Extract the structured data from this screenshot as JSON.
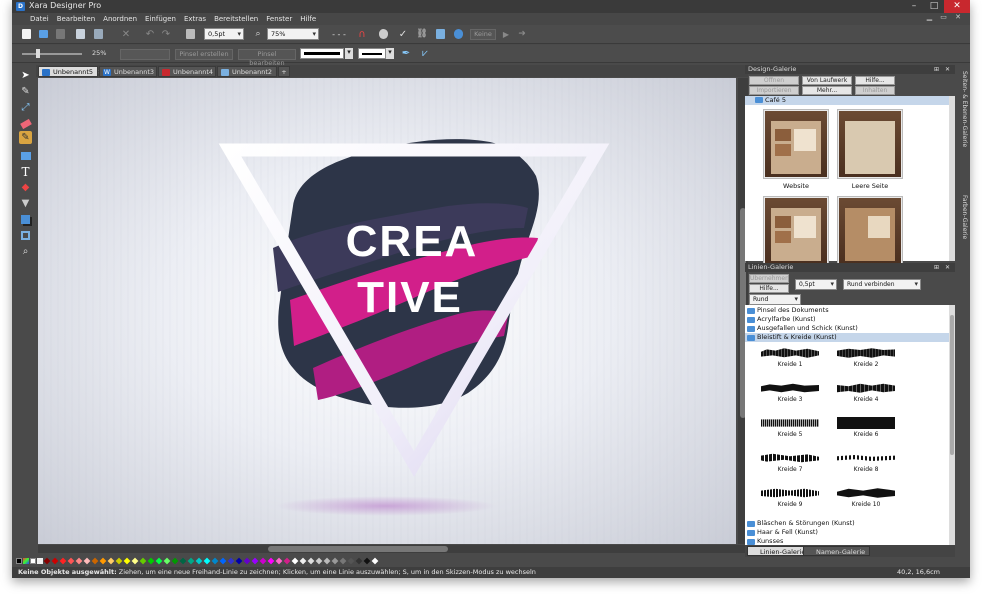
{
  "app": {
    "title": "Xara Designer Pro",
    "icon": "D"
  },
  "window_controls": {
    "minimize": "–",
    "maximize": "□",
    "close": "✕"
  },
  "menu": [
    "Datei",
    "Bearbeiten",
    "Anordnen",
    "Einfügen",
    "Extras",
    "Bereitstellen",
    "Fenster",
    "Hilfe"
  ],
  "toolbar1": {
    "line_width": "0,5pt",
    "zoom": "75%",
    "disabled_button": "Keine"
  },
  "toolbar2": {
    "transparency": "25%",
    "brush_create": "Pinsel erstellen",
    "brush_edit": "Pinsel bearbeiten"
  },
  "tabs": [
    {
      "label": "Unbenannt5",
      "icon": "doc-icon",
      "active": true
    },
    {
      "label": "Unbenannt3",
      "icon": "word-icon",
      "active": false
    },
    {
      "label": "Unbenannt4",
      "icon": "page-icon",
      "active": false
    },
    {
      "label": "Unbenannt2",
      "icon": "photo-icon",
      "active": false
    }
  ],
  "artwork": {
    "line1": "CREA",
    "line2": "TIVE"
  },
  "design_gallery": {
    "title": "Design-Galerie",
    "buttons": [
      "Öffnen",
      "Von Laufwerk",
      "Hilfe...",
      "Importieren",
      "Mehr...",
      "Inhalten"
    ],
    "folder": "Café 5",
    "items": [
      {
        "caption": "Website"
      },
      {
        "caption": "Leere Seite"
      },
      {
        "caption": ""
      },
      {
        "caption": ""
      }
    ]
  },
  "line_gallery": {
    "title": "Linien-Galerie",
    "buttons": {
      "apply": "Übernehmen",
      "help": "Hilfe..."
    },
    "width": "0,5pt",
    "join": "Rund verbinden",
    "cap": "Rund",
    "folders_top": [
      "Pinsel des Dokuments",
      "Acrylfarbe (Kunst)",
      "Ausgefallen und Schick (Kunst)",
      "Bleistift & Kreide (Kunst)"
    ],
    "strokes": [
      "Kreide 1",
      "Kreide 2",
      "Kreide 3",
      "Kreide 4",
      "Kreide 5",
      "Kreide 6",
      "Kreide 7",
      "Kreide 8",
      "Kreide 9",
      "Kreide 10"
    ],
    "folders_bottom": [
      "Bläschen & Störungen (Kunst)",
      "Haar & Fell (Kunst)",
      "Kunsses"
    ]
  },
  "panel_tabs": [
    "Linien-Galerie",
    "Namen-Galerie"
  ],
  "side_tabs": [
    "Seiten- & Ebenen-Galerie",
    "Farben-Galerie"
  ],
  "status": {
    "bold": "Keine Objekte ausgewählt:",
    "text": " Ziehen, um eine neue Freihand-Linie zu zeichnen; Klicken, um eine Linie auszuwählen; S, um in den Skizzen-Modus zu wechseln",
    "coords": "40,2, 16,6cm"
  },
  "colors": {
    "accent": "#c8282e",
    "brand": "#2a72c8",
    "magenta": "#d21f8a",
    "navy": "#2d3548"
  }
}
